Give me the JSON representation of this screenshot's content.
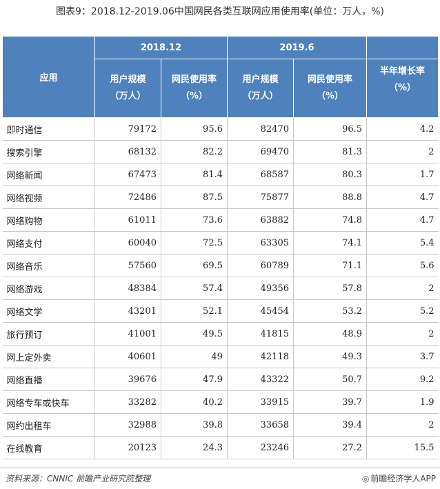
{
  "title": "图表9：2018.12-2019.06中国网民各类互联网应用使用率(单位：万人，%)",
  "table": {
    "group_headers": [
      "2018.12",
      "2019.6"
    ],
    "app_header": "应用",
    "col_headers": [
      {
        "line1": "用户规模",
        "line2": "（万人）"
      },
      {
        "line1": "网民使用率",
        "line2": "（%）"
      },
      {
        "line1": "用户规模",
        "line2": "（万人）"
      },
      {
        "line1": "网民使用率",
        "line2": "（%）"
      },
      {
        "line1": "半年增长率",
        "line2": "（%）"
      }
    ],
    "rows": [
      {
        "app": "即时通信",
        "users_2018": "79172",
        "rate_2018": "95.6",
        "users_2019": "82470",
        "rate_2019": "96.5",
        "growth": "4.2"
      },
      {
        "app": "搜索引擎",
        "users_2018": "68132",
        "rate_2018": "82.2",
        "users_2019": "69470",
        "rate_2019": "81.3",
        "growth": "2"
      },
      {
        "app": "网络新闻",
        "users_2018": "67473",
        "rate_2018": "81.4",
        "users_2019": "68587",
        "rate_2019": "80.3",
        "growth": "1.7"
      },
      {
        "app": "网络视频",
        "users_2018": "72486",
        "rate_2018": "87.5",
        "users_2019": "75877",
        "rate_2019": "88.8",
        "growth": "4.7"
      },
      {
        "app": "网络购物",
        "users_2018": "61011",
        "rate_2018": "73.6",
        "users_2019": "63882",
        "rate_2019": "74.8",
        "growth": "4.7"
      },
      {
        "app": "网络支付",
        "users_2018": "60040",
        "rate_2018": "72.5",
        "users_2019": "63305",
        "rate_2019": "74.1",
        "growth": "5.4"
      },
      {
        "app": "网络音乐",
        "users_2018": "57560",
        "rate_2018": "69.5",
        "users_2019": "60789",
        "rate_2019": "71.1",
        "growth": "5.6"
      },
      {
        "app": "网络游戏",
        "users_2018": "48384",
        "rate_2018": "57.4",
        "users_2019": "49356",
        "rate_2019": "57.8",
        "growth": "2"
      },
      {
        "app": "网络文学",
        "users_2018": "43201",
        "rate_2018": "52.1",
        "users_2019": "45454",
        "rate_2019": "53.2",
        "growth": "5.2"
      },
      {
        "app": "旅行预订",
        "users_2018": "41001",
        "rate_2018": "49.5",
        "users_2019": "41815",
        "rate_2019": "48.9",
        "growth": "2"
      },
      {
        "app": "网上定外卖",
        "users_2018": "40601",
        "rate_2018": "49",
        "users_2019": "42118",
        "rate_2019": "49.3",
        "growth": "3.7"
      },
      {
        "app": "网络直播",
        "users_2018": "39676",
        "rate_2018": "47.9",
        "users_2019": "43322",
        "rate_2019": "50.7",
        "growth": "9.2"
      },
      {
        "app": "网络专车或快车",
        "users_2018": "33282",
        "rate_2018": "40.2",
        "users_2019": "33915",
        "rate_2019": "39.7",
        "growth": "1.9"
      },
      {
        "app": "网约出租车",
        "users_2018": "32988",
        "rate_2018": "39.8",
        "users_2019": "33658",
        "rate_2019": "39.4",
        "growth": "2"
      },
      {
        "app": "在线教育",
        "users_2018": "20123",
        "rate_2018": "24.3",
        "users_2019": "23246",
        "rate_2019": "27.2",
        "growth": "15.5"
      }
    ]
  },
  "footer": {
    "source": "资料来源：CNNIC 前瞻产业研究院整理",
    "brand_icon": "chat-bubble-icon",
    "brand_glyph": "◎",
    "brand": "前瞻经济学人APP"
  },
  "colors": {
    "header_bg": "#4f81bd",
    "header_text": "#ffffff"
  }
}
